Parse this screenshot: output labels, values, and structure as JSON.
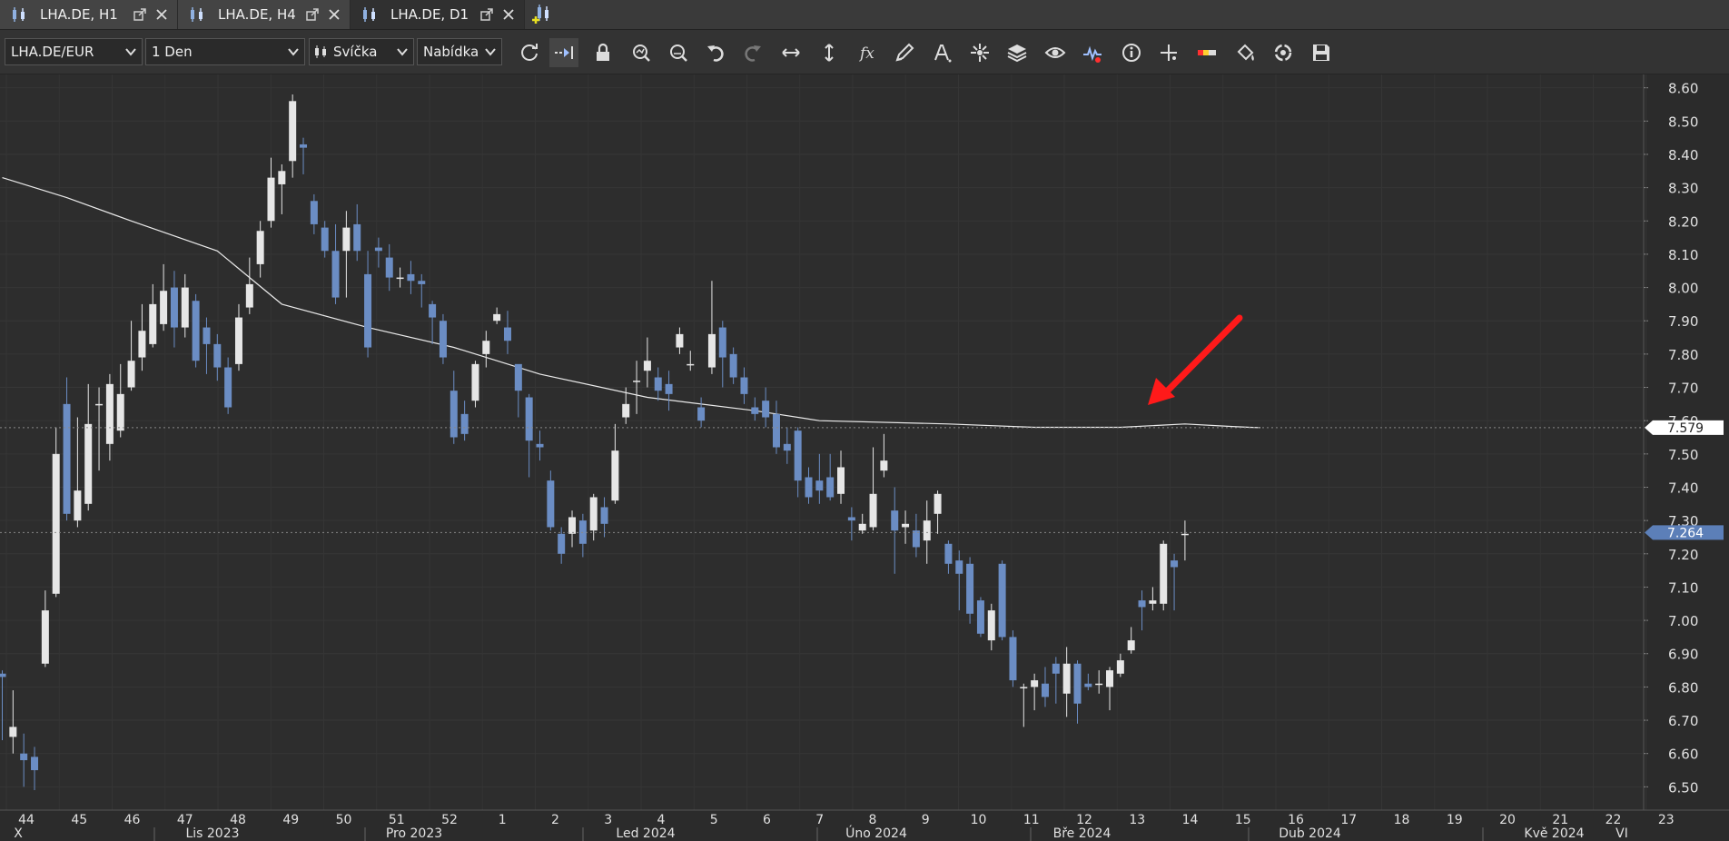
{
  "tabs": [
    {
      "label": "LHA.DE, H1",
      "active": false
    },
    {
      "label": "LHA.DE, H4",
      "active": false
    },
    {
      "label": "LHA.DE, D1",
      "active": true
    }
  ],
  "toolbar": {
    "symbol": "LHA.DE/EUR",
    "timeframe": "1 Den",
    "chart_style": "Svíčka",
    "price_side": "Nabídka",
    "buttons": [
      "refresh-icon",
      "scroll-to-end-icon",
      "lock-icon",
      "zoom-in-icon",
      "zoom-out-icon",
      "undo-icon",
      "redo-icon",
      "horizontal-stretch-icon",
      "vertical-stretch-icon",
      "function-icon",
      "pencil-icon",
      "text-tool-icon",
      "crosshair-tool-icon",
      "layers-icon",
      "eye-icon",
      "heartbeat-icon",
      "info-icon",
      "cross-cursor-icon",
      "color-bar-icon",
      "paint-bucket-icon",
      "cycle-icon",
      "save-icon"
    ]
  },
  "colors": {
    "background": "#2d2d2d",
    "bull": "#e6e6e6",
    "bear": "#6b8dc4",
    "ma_line": "#ffffff",
    "arrow": "#ff1a1a",
    "price_tag_bg": "#5c7fb8"
  },
  "chart_data": {
    "type": "candlestick",
    "ylim": [
      6.43,
      8.64
    ],
    "yticks": [
      6.5,
      6.6,
      6.7,
      6.8,
      6.9,
      7.0,
      7.1,
      7.2,
      7.3,
      7.4,
      7.5,
      7.6,
      7.7,
      7.8,
      7.9,
      8.0,
      8.1,
      8.2,
      8.3,
      8.4,
      8.5,
      8.6
    ],
    "ytick_labels": [
      "6.50",
      "6.60",
      "6.70",
      "6.80",
      "6.90",
      "7.00",
      "7.10",
      "7.20",
      "7.30",
      "7.40",
      "7.50",
      "7.60",
      "7.70",
      "7.80",
      "7.90",
      "8.00",
      "8.10",
      "8.20",
      "8.30",
      "8.40",
      "8.50",
      "8.60"
    ],
    "week_labels": [
      "44",
      "45",
      "46",
      "47",
      "48",
      "49",
      "50",
      "51",
      "52",
      "1",
      "2",
      "3",
      "4",
      "5",
      "6",
      "7",
      "8",
      "9",
      "10",
      "11",
      "12",
      "13",
      "14",
      "15",
      "16",
      "17",
      "18",
      "19",
      "20",
      "21",
      "22",
      "23"
    ],
    "month_labels": [
      "X",
      "Lis 2023",
      "Pro 2023",
      "Led 2024",
      "Úno 2024",
      "Bře 2024",
      "Dub 2024",
      "Kvě 2024",
      "VI"
    ],
    "candles": [
      [
        6.84,
        6.83,
        6.85,
        6.64
      ],
      [
        6.65,
        6.68,
        6.79,
        6.6
      ],
      [
        6.6,
        6.58,
        6.66,
        6.5
      ],
      [
        6.59,
        6.55,
        6.62,
        6.49
      ],
      [
        6.87,
        7.03,
        7.09,
        6.86
      ],
      [
        7.08,
        7.5,
        7.58,
        7.07
      ],
      [
        7.65,
        7.32,
        7.73,
        7.3
      ],
      [
        7.3,
        7.39,
        7.61,
        7.28
      ],
      [
        7.35,
        7.59,
        7.71,
        7.33
      ],
      [
        7.65,
        7.65,
        7.7,
        7.45
      ],
      [
        7.53,
        7.71,
        7.74,
        7.48
      ],
      [
        7.57,
        7.68,
        7.77,
        7.55
      ],
      [
        7.7,
        7.78,
        7.9,
        7.69
      ],
      [
        7.79,
        7.87,
        7.95,
        7.75
      ],
      [
        7.83,
        7.95,
        8.01,
        7.82
      ],
      [
        7.89,
        7.99,
        8.07,
        7.87
      ],
      [
        8.0,
        7.88,
        8.05,
        7.82
      ],
      [
        7.88,
        8.0,
        8.04,
        7.85
      ],
      [
        7.96,
        7.78,
        7.98,
        7.76
      ],
      [
        7.88,
        7.83,
        7.91,
        7.74
      ],
      [
        7.83,
        7.76,
        7.86,
        7.72
      ],
      [
        7.76,
        7.64,
        7.79,
        7.62
      ],
      [
        7.77,
        7.91,
        7.95,
        7.75
      ],
      [
        7.94,
        8.01,
        8.09,
        7.92
      ],
      [
        8.07,
        8.17,
        8.2,
        8.03
      ],
      [
        8.2,
        8.33,
        8.39,
        8.18
      ],
      [
        8.31,
        8.35,
        8.37,
        8.22
      ],
      [
        8.38,
        8.56,
        8.58,
        8.33
      ],
      [
        8.43,
        8.42,
        8.45,
        8.34
      ],
      [
        8.26,
        8.19,
        8.28,
        8.16
      ],
      [
        8.18,
        8.11,
        8.2,
        8.09
      ],
      [
        8.11,
        7.97,
        8.19,
        7.95
      ],
      [
        8.11,
        8.18,
        8.23,
        7.97
      ],
      [
        8.19,
        8.11,
        8.25,
        8.08
      ],
      [
        8.04,
        7.82,
        8.11,
        7.79
      ],
      [
        8.12,
        8.11,
        8.15,
        8.06
      ],
      [
        8.09,
        8.03,
        8.13,
        7.99
      ],
      [
        8.03,
        8.03,
        8.06,
        8.0
      ],
      [
        8.04,
        8.02,
        8.08,
        7.98
      ],
      [
        8.02,
        8.01,
        8.04,
        7.94
      ],
      [
        7.95,
        7.91,
        7.96,
        7.83
      ],
      [
        7.9,
        7.79,
        7.92,
        7.77
      ],
      [
        7.69,
        7.55,
        7.75,
        7.53
      ],
      [
        7.62,
        7.56,
        7.66,
        7.54
      ],
      [
        7.66,
        7.77,
        7.78,
        7.64
      ],
      [
        7.8,
        7.84,
        7.87,
        7.76
      ],
      [
        7.9,
        7.92,
        7.94,
        7.89
      ],
      [
        7.88,
        7.84,
        7.93,
        7.8
      ],
      [
        7.77,
        7.69,
        7.7,
        7.61
      ],
      [
        7.67,
        7.54,
        7.68,
        7.43
      ],
      [
        7.53,
        7.52,
        7.57,
        7.48
      ],
      [
        7.42,
        7.28,
        7.45,
        7.27
      ],
      [
        7.26,
        7.2,
        7.28,
        7.17
      ],
      [
        7.26,
        7.31,
        7.33,
        7.22
      ],
      [
        7.3,
        7.23,
        7.32,
        7.19
      ],
      [
        7.27,
        7.37,
        7.38,
        7.24
      ],
      [
        7.34,
        7.29,
        7.37,
        7.25
      ],
      [
        7.36,
        7.51,
        7.59,
        7.35
      ],
      [
        7.61,
        7.65,
        7.7,
        7.59
      ],
      [
        7.72,
        7.72,
        7.78,
        7.62
      ],
      [
        7.75,
        7.78,
        7.85,
        7.7
      ],
      [
        7.73,
        7.69,
        7.76,
        7.66
      ],
      [
        7.71,
        7.68,
        7.75,
        7.63
      ],
      [
        7.82,
        7.86,
        7.88,
        7.8
      ],
      [
        7.77,
        7.77,
        7.81,
        7.75
      ],
      [
        7.64,
        7.6,
        7.67,
        7.58
      ],
      [
        7.76,
        7.86,
        8.02,
        7.74
      ],
      [
        7.88,
        7.79,
        7.9,
        7.7
      ],
      [
        7.8,
        7.73,
        7.82,
        7.71
      ],
      [
        7.73,
        7.68,
        7.76,
        7.65
      ],
      [
        7.64,
        7.62,
        7.67,
        7.6
      ],
      [
        7.66,
        7.61,
        7.7,
        7.58
      ],
      [
        7.62,
        7.52,
        7.66,
        7.5
      ],
      [
        7.53,
        7.51,
        7.58,
        7.47
      ],
      [
        7.57,
        7.42,
        7.58,
        7.37
      ],
      [
        7.43,
        7.37,
        7.46,
        7.35
      ],
      [
        7.42,
        7.39,
        7.5,
        7.35
      ],
      [
        7.43,
        7.37,
        7.5,
        7.36
      ],
      [
        7.38,
        7.46,
        7.51,
        7.35
      ],
      [
        7.31,
        7.3,
        7.34,
        7.24
      ],
      [
        7.27,
        7.29,
        7.32,
        7.26
      ],
      [
        7.28,
        7.38,
        7.52,
        7.27
      ],
      [
        7.45,
        7.48,
        7.56,
        7.43
      ],
      [
        7.33,
        7.27,
        7.4,
        7.14
      ],
      [
        7.28,
        7.29,
        7.33,
        7.23
      ],
      [
        7.27,
        7.22,
        7.32,
        7.19
      ],
      [
        7.24,
        7.3,
        7.36,
        7.17
      ],
      [
        7.32,
        7.38,
        7.39,
        7.26
      ],
      [
        7.23,
        7.17,
        7.24,
        7.14
      ],
      [
        7.18,
        7.14,
        7.21,
        7.03
      ],
      [
        7.17,
        7.02,
        7.19,
        6.99
      ],
      [
        7.06,
        6.96,
        7.07,
        6.95
      ],
      [
        6.94,
        7.03,
        7.05,
        6.91
      ],
      [
        7.17,
        6.95,
        7.18,
        6.94
      ],
      [
        6.95,
        6.82,
        6.97,
        6.8
      ],
      [
        6.8,
        6.8,
        6.81,
        6.68
      ],
      [
        6.8,
        6.82,
        6.84,
        6.73
      ],
      [
        6.81,
        6.77,
        6.86,
        6.74
      ],
      [
        6.87,
        6.84,
        6.89,
        6.75
      ],
      [
        6.78,
        6.87,
        6.92,
        6.71
      ],
      [
        6.87,
        6.75,
        6.88,
        6.69
      ],
      [
        6.81,
        6.8,
        6.84,
        6.79
      ],
      [
        6.81,
        6.81,
        6.85,
        6.78
      ],
      [
        6.8,
        6.85,
        6.86,
        6.73
      ],
      [
        6.84,
        6.88,
        6.9,
        6.83
      ],
      [
        6.91,
        6.94,
        6.98,
        6.9
      ],
      [
        7.06,
        7.04,
        7.09,
        6.97
      ],
      [
        7.05,
        7.06,
        7.1,
        7.03
      ],
      [
        7.05,
        7.23,
        7.24,
        7.03
      ],
      [
        7.18,
        7.16,
        7.2,
        7.03
      ],
      [
        7.26,
        7.26,
        7.3,
        7.18
      ]
    ],
    "ma_line": [
      [
        0,
        8.33
      ],
      [
        6,
        8.27
      ],
      [
        12,
        8.2
      ],
      [
        20,
        8.11
      ],
      [
        26,
        7.95
      ],
      [
        34,
        7.88
      ],
      [
        42,
        7.82
      ],
      [
        50,
        7.74
      ],
      [
        60,
        7.67
      ],
      [
        70,
        7.63
      ],
      [
        76,
        7.6
      ],
      [
        88,
        7.59
      ],
      [
        96,
        7.58
      ],
      [
        104,
        7.58
      ],
      [
        110,
        7.59
      ],
      [
        114,
        7.583
      ],
      [
        116,
        7.58
      ],
      [
        117,
        7.579
      ]
    ],
    "current_ma": "7.579",
    "current_price": "7.264"
  }
}
